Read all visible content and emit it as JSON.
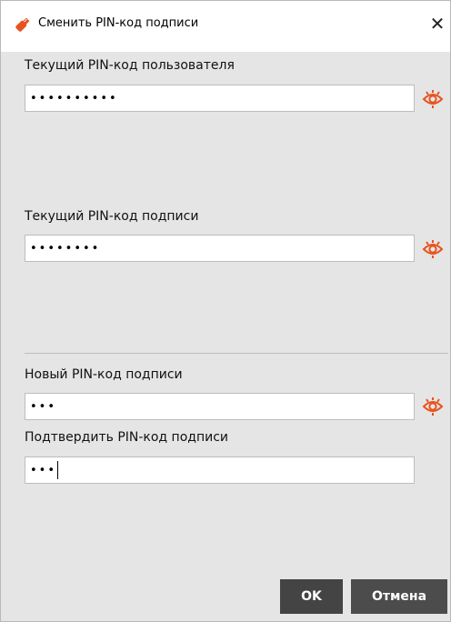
{
  "window": {
    "title": "Сменить PIN-код подписи",
    "close_label": "✕"
  },
  "fields": {
    "current_user_pin": {
      "label": "Текущий PIN-код пользователя",
      "value": "••••••••••"
    },
    "current_sign_pin": {
      "label": "Текущий PIN-код подписи",
      "value": "••••••••"
    },
    "new_sign_pin": {
      "label": "Новый PIN-код подписи",
      "value": "•••"
    },
    "confirm_sign_pin": {
      "label": "Подтвердить PIN-код подписи",
      "value": "•••"
    }
  },
  "buttons": {
    "ok": "OK",
    "cancel": "Отмена"
  },
  "icons": {
    "title": "usb-token-icon",
    "show_password": "eye-icon"
  },
  "colors": {
    "accent": "#e8531e",
    "button": "#444444"
  }
}
